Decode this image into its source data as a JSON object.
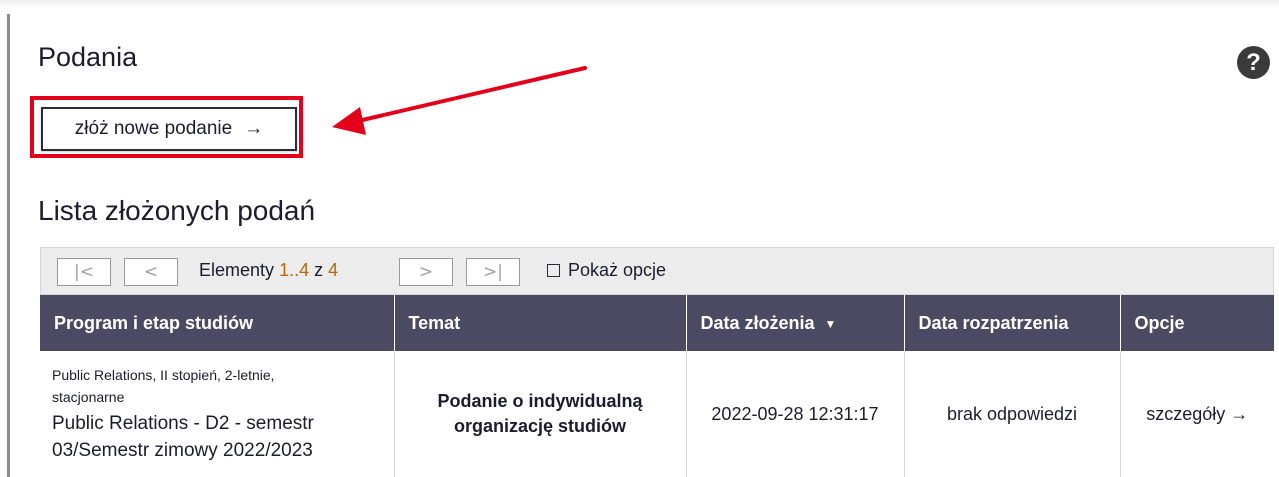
{
  "page": {
    "title": "Podania",
    "help_label": "?"
  },
  "actions": {
    "new_application_label": "złóż nowe podanie",
    "new_application_arrow": "→"
  },
  "list": {
    "title": "Lista złożonych podań",
    "pager": {
      "first_label": "|<",
      "prev_label": "<",
      "next_label": ">",
      "last_label": ">|",
      "elements_label": "Elementy",
      "range": "1..4",
      "of_label": "z",
      "total": "4",
      "show_options_label": "Pokaż opcje"
    },
    "columns": [
      "Program i etap studiów",
      "Temat",
      "Data złożenia",
      "Data rozpatrzenia",
      "Opcje"
    ],
    "sort_indicator": "▼",
    "rows": [
      {
        "program_line1": "Public Relations, II stopień, 2-letnie,",
        "program_line2": "stacjonarne",
        "program_stage": "Public Relations - D2 - semestr 03/Semestr zimowy 2022/2023",
        "subject": "Podanie o indywidualną organizację studiów",
        "submitted": "2022-09-28 12:31:17",
        "reviewed": "brak odpowiedzi",
        "details_label": "szczegóły",
        "details_arrow": "→"
      }
    ]
  },
  "colors": {
    "accent_red": "#e3001b",
    "header_bg": "#4a4a63",
    "pager_highlight": "#b8640a"
  },
  "icons": {
    "help": "question-circle-icon",
    "pointer": "red-arrow-icon",
    "checkbox": "checkbox-unchecked-icon"
  }
}
